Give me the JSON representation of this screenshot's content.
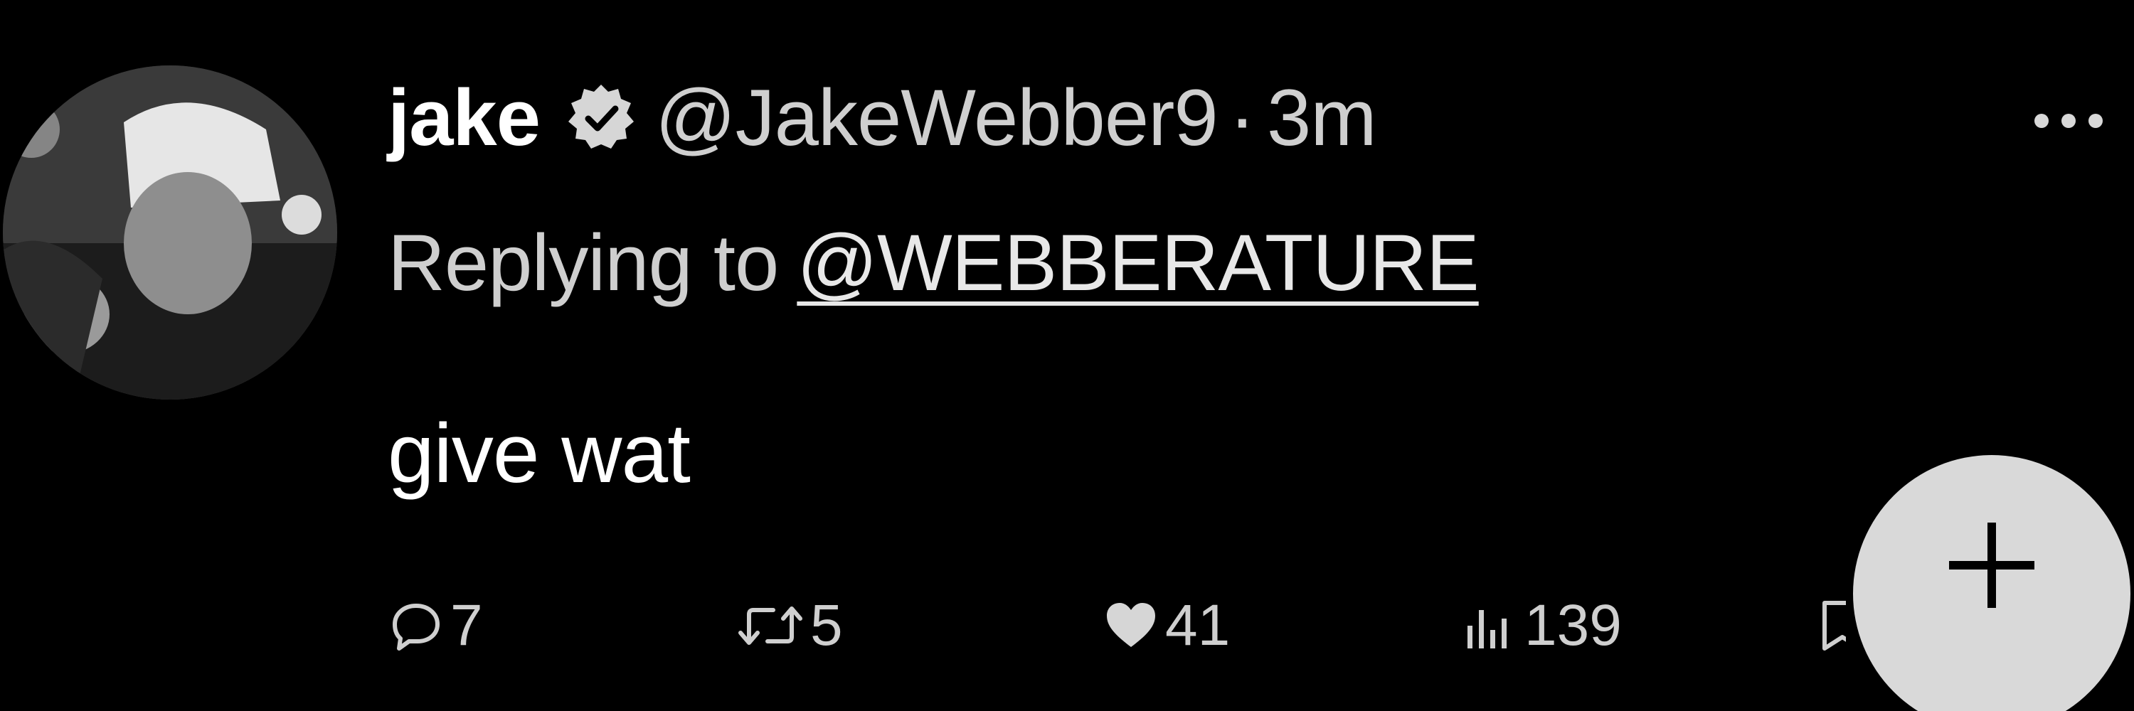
{
  "tweet": {
    "author": {
      "name": "jake",
      "handle": "@JakeWebber9",
      "separator": "·",
      "time": "3m",
      "verified": true
    },
    "replying_to": {
      "prefix": "Replying to",
      "mention": "@WEBBERATURE"
    },
    "text": "give wat",
    "actions": {
      "replies": "7",
      "retweets": "5",
      "likes": "41",
      "views": "139"
    }
  },
  "icons": {
    "more": "more-dots-icon",
    "reply": "reply-bubble-icon",
    "retweet": "retweet-icon",
    "like": "heart-icon",
    "views": "views-chart-icon",
    "bookmark": "bookmark-icon",
    "compose": "plus-icon"
  },
  "colors": {
    "background": "#000000",
    "primary_text": "#ffffff",
    "secondary_text": "#cfcfcf",
    "fab": "#d9d9d9"
  }
}
